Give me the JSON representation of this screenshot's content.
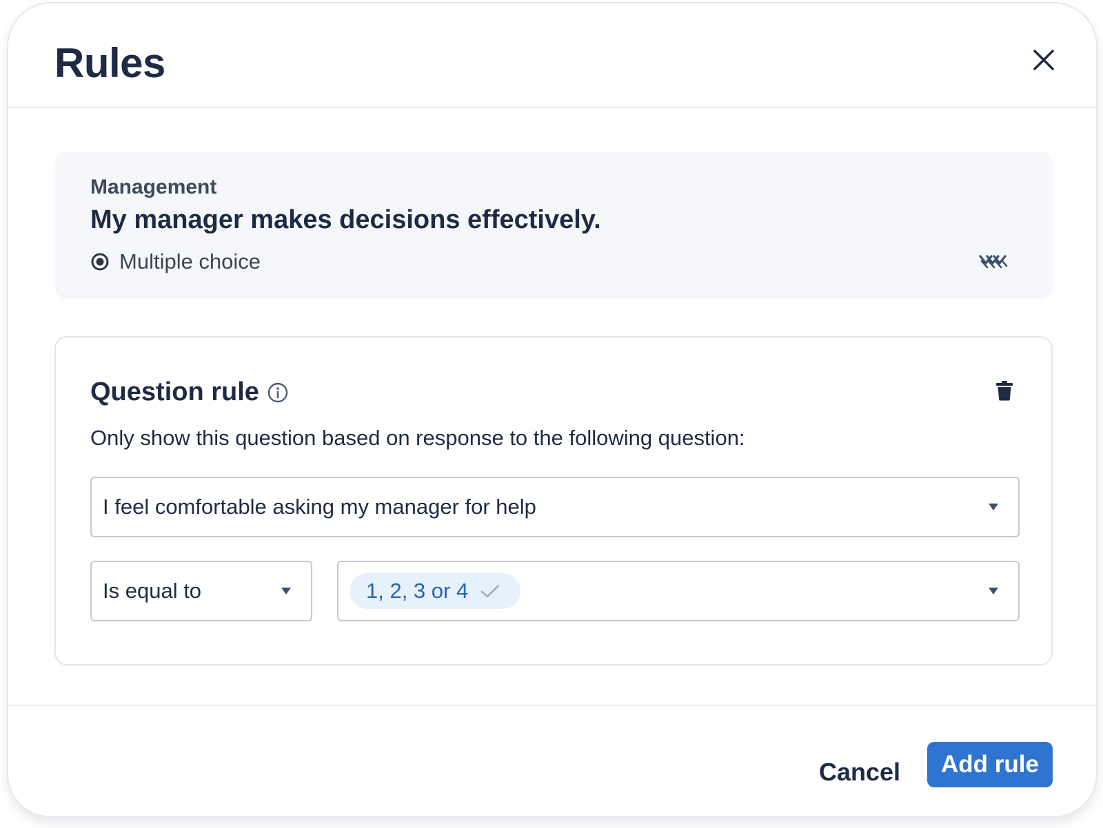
{
  "dialog": {
    "title": "Rules",
    "close_icon": "close-icon"
  },
  "question": {
    "category": "Management",
    "text": "My manager makes decisions effectively.",
    "type_label": "Multiple choice",
    "type_icon": "radio-selected-icon",
    "logic_icon": "branching-logic-icon"
  },
  "rule": {
    "heading": "Question rule",
    "info_icon": "info-icon",
    "delete_icon": "trash-icon",
    "description": "Only show this question based on response to the following question:",
    "source_question": "I feel comfortable asking my manager for help",
    "operator": "Is equal to",
    "selected_values": "1, 2, 3 or 4"
  },
  "footer": {
    "cancel_label": "Cancel",
    "submit_label": "Add rule"
  },
  "colors": {
    "primary": "#2f74d0",
    "chip_background": "#e6f1fb",
    "chip_text": "#2362b8",
    "text_dark": "#1f2a44",
    "summary_background": "#f6f7fa"
  }
}
